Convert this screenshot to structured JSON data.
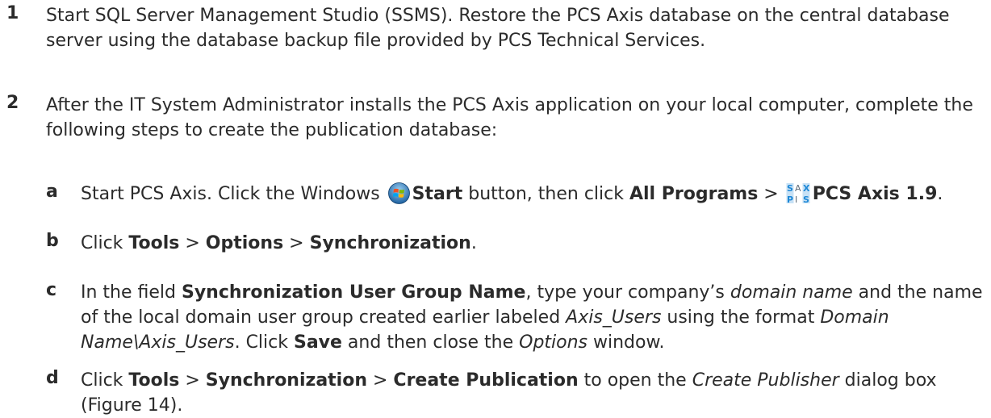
{
  "steps": [
    {
      "number": "1",
      "segments": [
        {
          "text": "Start SQL Server Management Studio (SSMS). Restore the PCS Axis database on the central database server using the database backup file provided by PCS Technical Services.",
          "style": "normal"
        }
      ]
    },
    {
      "number": "2",
      "segments": [
        {
          "text": "After the IT System Administrator installs the PCS Axis application on your local computer, complete the following steps to create the publication database:",
          "style": "normal"
        }
      ]
    }
  ],
  "substeps": [
    {
      "letter": "a",
      "parts": {
        "t1": "Start PCS Axis. Click the Windows ",
        "start": "Start",
        "t2": " button, then click ",
        "all_programs": "All Programs",
        "sep": " > ",
        "pcs_axis": "PCS Axis 1.9",
        "end": "."
      }
    },
    {
      "letter": "b",
      "parts": {
        "t1": "Click ",
        "tools": "Tools",
        "sep1": " > ",
        "options": "Options",
        "sep2": " > ",
        "synchronization": "Synchronization",
        "end": "."
      }
    },
    {
      "letter": "c",
      "parts": {
        "t1": "In the field ",
        "field": "Synchronization User Group Name",
        "t2": ", type your company’s ",
        "domain": "domain name",
        "t3": " and the name of the local domain user group created earlier labeled ",
        "axis_users": "Axis_Users",
        "t4": " using the format ",
        "format": "Domain Name\\Axis_Users",
        "t5": ". Click ",
        "save": "Save",
        "t6": " and then close the ",
        "options_window": "Options",
        "t7": " window."
      }
    },
    {
      "letter": "d",
      "parts": {
        "t1": "Click ",
        "tools": "Tools",
        "sep1": " > ",
        "synchronization": "Synchronization",
        "sep2": " > ",
        "create_publication": "Create Publication",
        "t2": " to open the ",
        "dialog": "Create Publisher",
        "t3": " dialog box (Figure 14)."
      }
    }
  ],
  "icons": {
    "windows_start": "windows-start-orb-icon",
    "pcs_axis": "pcs-axis-logo-icon"
  },
  "colors": {
    "text": "#2b2b2b",
    "axis_logo": "#1e88d6"
  }
}
